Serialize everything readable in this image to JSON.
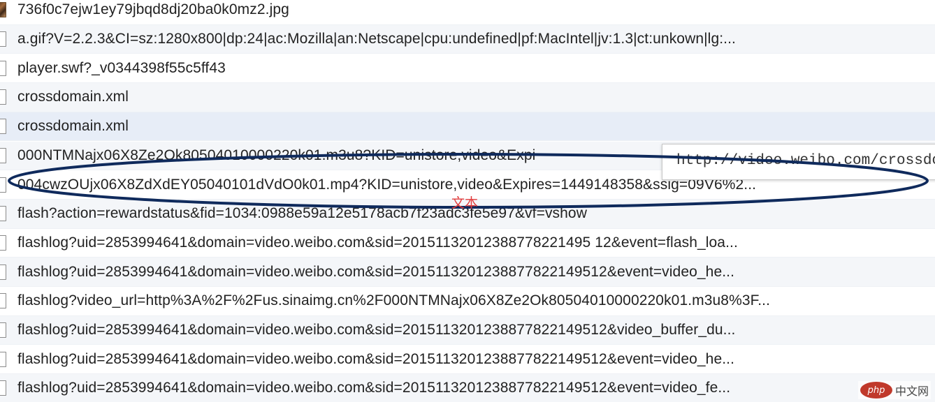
{
  "requests": [
    {
      "name": "736f0c7ejw1ey79jbqd8dj20ba0k0mz2.jpg",
      "icon": "image-thumbnail-icon"
    },
    {
      "name": "a.gif?V=2.2.3&CI=sz:1280x800|dp:24|ac:Mozilla|an:Netscape|cpu:undefined|pf:MacIntel|jv:1.3|ct:unkown|lg:...",
      "icon": "file-icon"
    },
    {
      "name": "player.swf?_v0344398f55c5ff43",
      "icon": "file-icon"
    },
    {
      "name": "crossdomain.xml",
      "icon": "file-icon"
    },
    {
      "name": "crossdomain.xml",
      "icon": "file-icon",
      "selected": true
    },
    {
      "name": "000NTMNajx06X8Ze2Ok80504010000220k01.m3u8?KID=unistore,video&Expi",
      "icon": "file-icon"
    },
    {
      "name": "004cwzOUjx06X8ZdXdEY05040101dVdO0k01.mp4?KID=unistore,video&Expires=1449148358&ssig=09V6%2...",
      "icon": "file-icon"
    },
    {
      "name": "flash?action=rewardstatus&fid=1034:0988e59a12e5178acb7f23adc3fe5e97&vf=vshow",
      "icon": "file-icon"
    },
    {
      "name": "flashlog?uid=2853994641&domain=video.weibo.com&sid=20151132012388778221495 12&event=flash_loa...",
      "icon": "file-icon"
    },
    {
      "name": "flashlog?uid=2853994641&domain=video.weibo.com&sid=2015113201238877822149512&event=video_he...",
      "icon": "file-icon"
    },
    {
      "name": "flashlog?video_url=http%3A%2F%2Fus.sinaimg.cn%2F000NTMNajx06X8Ze2Ok80504010000220k01.m3u8%3F...",
      "icon": "file-icon"
    },
    {
      "name": "flashlog?uid=2853994641&domain=video.weibo.com&sid=2015113201238877822149512&video_buffer_du...",
      "icon": "file-icon"
    },
    {
      "name": "flashlog?uid=2853994641&domain=video.weibo.com&sid=2015113201238877822149512&event=video_he...",
      "icon": "file-icon"
    },
    {
      "name": "flashlog?uid=2853994641&domain=video.weibo.com&sid=2015113201238877822149512&event=video_fe...",
      "icon": "file-icon"
    }
  ],
  "tooltip": {
    "text": "http://video.weibo.com/crossdo"
  },
  "annotation": {
    "label": "文本",
    "ellipse_color": "#0f2a5c",
    "label_color": "#e23b3b",
    "highlights_row": 6
  },
  "watermark": {
    "logo": "php",
    "text": "中文网"
  },
  "colors": {
    "row_alt": "#f4f6f9",
    "row_selected": "#e7edf7",
    "text": "#222222"
  }
}
